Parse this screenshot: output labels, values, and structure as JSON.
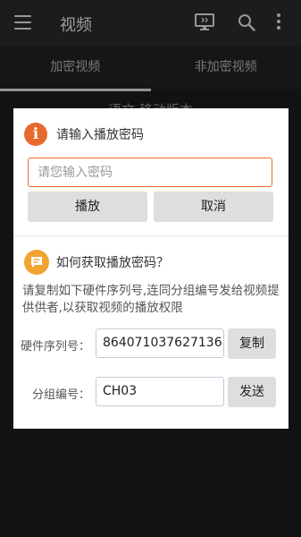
{
  "appbar": {
    "title": "视频",
    "icons": [
      "menu-icon",
      "cast-icon",
      "search-icon",
      "more-vert-icon"
    ]
  },
  "tabs": [
    {
      "label": "加密视频",
      "active": true
    },
    {
      "label": "非加密视频",
      "active": false
    }
  ],
  "behind": {
    "text": "语文 移动版本"
  },
  "dialog": {
    "title": "请输入播放密码",
    "password": {
      "value": "",
      "placeholder": "请您输入密码"
    },
    "play_label": "播放",
    "cancel_label": "取消",
    "help_title": "如何获取播放密码？",
    "help_desc": "请复制如下硬件序列号,连同分组编号发给视频提供供者,以获取视频的播放权限",
    "hw_label": "硬件序列号：",
    "hw_value": "864071037627136",
    "copy_label": "复制",
    "group_label": "分组编号：",
    "group_value": "CH03",
    "send_label": "发送"
  },
  "colors": {
    "accent": "#e8692d",
    "help_icon": "#f2a431",
    "appbar": "#2b2b2d"
  }
}
